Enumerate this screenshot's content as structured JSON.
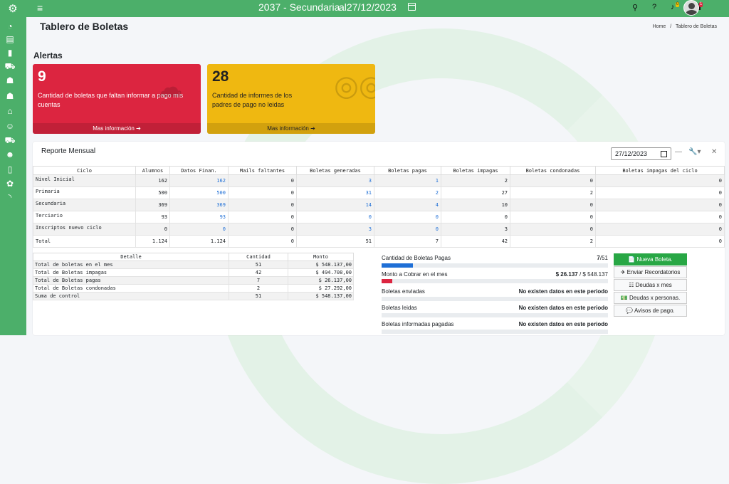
{
  "topbar": {
    "title": "2037 - Secundaria",
    "date": "al27/12/2023",
    "notif_count": "0",
    "msg_count": "1"
  },
  "page": {
    "title": "Tablero de Boletas",
    "breadcrumb_home": "Home",
    "breadcrumb_sep": "/",
    "breadcrumb_current": "Tablero de Boletas"
  },
  "alerts": {
    "title": "Alertas",
    "box1": {
      "number": "9",
      "text": "Cantidad de boletas que faltan informar a pago mis cuentas",
      "footer": "Mas información ➔",
      "color": "#dc2540"
    },
    "box2": {
      "number": "28",
      "text": "Cantidad de informes de los padres de pago no leidas",
      "footer": "Mas información ➔",
      "color": "#efb811"
    }
  },
  "report": {
    "title": "Reporte Mensual",
    "date_value": "27/12/2023",
    "tools": {
      "minimize": "—",
      "wrench": "🔧▾",
      "close": "✕"
    },
    "columns": [
      "Ciclo",
      "Alumnos",
      "Datos Finan.",
      "Mails faltantes",
      "Boletas generadas",
      "Boletas pagas",
      "Boletas impagas",
      "Boletas condonadas",
      "Boletas impagas del ciclo"
    ],
    "rows": [
      [
        "Nivel Inicial",
        "162",
        "162",
        "0",
        "3",
        "1",
        "2",
        "0",
        "0"
      ],
      [
        "Primaria",
        "500",
        "500",
        "0",
        "31",
        "2",
        "27",
        "2",
        "0"
      ],
      [
        "Secundaria",
        "369",
        "369",
        "0",
        "14",
        "4",
        "10",
        "0",
        "0"
      ],
      [
        "Terciario",
        "93",
        "93",
        "0",
        "0",
        "0",
        "0",
        "0",
        "0"
      ],
      [
        "Inscriptos nuevo ciclo",
        "0",
        "0",
        "0",
        "3",
        "0",
        "3",
        "0",
        "0"
      ],
      [
        "Total",
        "1.124",
        "1.124",
        "0",
        "51",
        "7",
        "42",
        "2",
        "0"
      ]
    ]
  },
  "detail": {
    "columns": [
      "Detalle",
      "Cantidad",
      "Monto"
    ],
    "rows": [
      [
        "Total de boletas en el mes",
        "51",
        "$ 548.137,00"
      ],
      [
        "Total de Boletas impagas",
        "42",
        "$ 494.708,00"
      ],
      [
        "Total de Boletas pagas",
        "7",
        "$ 26.137,00"
      ],
      [
        "Total de Boletas condonadas",
        "2",
        "$ 27.292,00"
      ],
      [
        "Suma de control",
        "51",
        "$ 548.137,00"
      ]
    ]
  },
  "stats": {
    "paid_label": "Cantidad de Boletas Pagas",
    "paid_value": "7",
    "paid_total": "/51",
    "paid_fraction": 0.137,
    "amount_label": "Monto a Cobrar en el mes",
    "amount_value": "$ 26.137",
    "amount_total": " / $ 548.137",
    "amount_fraction": 0.048,
    "sent_label": "Boletas enviadas",
    "sent_value": "No existen datos en este periodo",
    "read_label": "Boletas leidas",
    "read_value": "No existen datos en este periodo",
    "informed_label": "Boletas informadas pagadas",
    "informed_value": "No existen datos en este periodo"
  },
  "buttons": {
    "new": "📄 Nueva Boleta.",
    "reminders": "✈ Enviar Recordatorios",
    "debts_month": "☷ Deudas x mes",
    "debts_people": "💵 Deudas x personas.",
    "payment_notices": "💬 Avisos de pago."
  }
}
